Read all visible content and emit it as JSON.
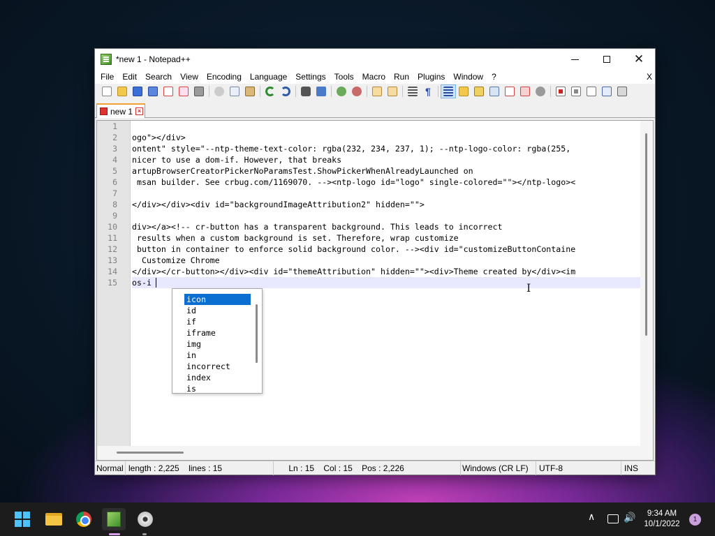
{
  "window": {
    "title": "*new 1 - Notepad++",
    "close_glyph": "✕"
  },
  "menu": {
    "items": [
      "File",
      "Edit",
      "Search",
      "View",
      "Encoding",
      "Language",
      "Settings",
      "Tools",
      "Macro",
      "Run",
      "Plugins",
      "Window",
      "?"
    ],
    "close_doc": "X"
  },
  "toolbar": {
    "icons": [
      "new-file-icon",
      "open-file-icon",
      "save-icon",
      "save-all-icon",
      "close-icon",
      "close-all-icon",
      "print-icon",
      "cut-icon",
      "copy-icon",
      "paste-icon",
      "undo-icon",
      "redo-icon",
      "find-icon",
      "replace-icon",
      "zoom-in-icon",
      "zoom-out-icon",
      "sync-vertical-icon",
      "sync-horizontal-icon",
      "word-wrap-icon",
      "show-all-chars-icon",
      "indent-guide-icon",
      "doc-map-icon",
      "function-list-icon",
      "folder-workspace-icon",
      "monitoring-icon",
      "record-macro-icon",
      "stop-macro-icon",
      "play-macro-icon",
      "run-macro-multiple-icon",
      "save-macro-icon"
    ]
  },
  "tab": {
    "label": "new 1"
  },
  "editor": {
    "line_numbers": [
      "1",
      "2",
      "3",
      "4",
      "5",
      "6",
      "7",
      "8",
      "9",
      "10",
      "11",
      "12",
      "13",
      "14",
      "15"
    ],
    "lines": [
      "",
      "ogo\"></div>",
      "ontent\" style=\"--ntp-theme-text-color: rgba(232, 234, 237, 1); --ntp-logo-color: rgba(255,",
      "nicer to use a dom-if. However, that breaks",
      "artupBrowserCreatorPickerNoParamsTest.ShowPickerWhenAlreadyLaunched on",
      " msan builder. See crbug.com/1169070. --><ntp-logo id=\"logo\" single-colored=\"\"></ntp-logo><",
      "",
      "</div></div><div id=\"backgroundImageAttribution2\" hidden=\"\">",
      "",
      "div></a><!-- cr-button has a transparent background. This leads to incorrect",
      " results when a custom background is set. Therefore, wrap customize",
      " button in container to enforce solid background color. --><div id=\"customizeButtonContaine",
      "  Customize Chrome",
      "</div></cr-button></div><div id=\"themeAttribution\" hidden=\"\"><div>Theme created by</div><im",
      "os-i"
    ]
  },
  "autocomplete": {
    "items": [
      "icon",
      "id",
      "if",
      "iframe",
      "img",
      "in",
      "incorrect",
      "index",
      "is"
    ],
    "selected_index": 0
  },
  "status": {
    "mode": "Normal",
    "length": "length : 2,225",
    "lines": "lines : 15",
    "ln": "Ln : 15",
    "col": "Col : 15",
    "pos": "Pos : 2,226",
    "eol": "Windows (CR LF)",
    "encoding": "UTF-8",
    "ins": "INS"
  },
  "taskbar": {
    "time": "9:34 AM",
    "date": "10/1/2022",
    "notifications": "1",
    "chevron": "∧",
    "volume_glyph": "🔊"
  }
}
